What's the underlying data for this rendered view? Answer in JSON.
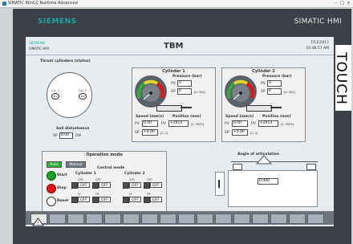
{
  "window": {
    "title": "SIMATIC WinCC Runtime Advanced"
  },
  "brand": {
    "siemens": "SIEMENS",
    "product": "SIMATIC HMI",
    "touch": "TOUCH"
  },
  "header": {
    "siemens": "SIEMENS",
    "hmi": "SIMATIC HMI",
    "title": "TBM",
    "date": "7/11/2017",
    "time": "10:48:57 AM"
  },
  "thrust": {
    "title": "Thrust cylinders (status)",
    "cyl1_label": "Cyl. 1",
    "cyl1_id": "#1",
    "cyl2_label": "Cyl. 2",
    "cyl2_id": "#2",
    "soil_label": "Soil disturbance",
    "sp_label": "SP",
    "sp_value": "0.00",
    "sp_unit": "ON"
  },
  "cylinder1": {
    "title": "Cylinder 1",
    "pressure_label": "Pressure (bar)",
    "pv_label": "PV",
    "pv_value": "0",
    "sp_label": "SP",
    "sp_value": "0",
    "pressure_range": "[0..350]",
    "speed_label": "Speed (mm/s)",
    "position_label": "Position (mm)",
    "speed_pv_label": "PV",
    "speed_pv": "0.00",
    "pos_pv_label": "PV",
    "pos_pv": "+2014",
    "pos_range": "[0..3000]",
    "speed_sp_label": "SP",
    "speed_sp": "+0.00",
    "speed_range": "[0..1]"
  },
  "cylinder2": {
    "title": "Cylinder 2",
    "pressure_label": "Pressure (bar)",
    "pv_label": "PV",
    "pv_value": "0",
    "sp_label": "SP",
    "sp_value": "0",
    "pressure_range": "[0..350]",
    "speed_label": "Speed (mm/s)",
    "position_label": "Position (mm)",
    "speed_pv_label": "PV",
    "speed_pv": "0.00",
    "pos_pv_label": "PV",
    "pos_pv": "+2014",
    "pos_range": "[0..3000]",
    "speed_sp_label": "SP",
    "speed_sp": "+0.00",
    "speed_range": "[0..1]"
  },
  "operation": {
    "title": "Operation mode",
    "auto": "Auto",
    "manual": "Manual",
    "control_mode": "Control mode",
    "start": "Start",
    "stop": "Stop",
    "reset": "Reset",
    "cyl1": "Cylinder 1",
    "cyl2": "Cylinder 2",
    "c1_a": "CFS",
    "c1_b": "CFP",
    "c1_c": "FF",
    "c1_d": "FR",
    "c2_a": "CFS",
    "c2_b": "CFP",
    "c2_c": "FF",
    "c2_d": "FR",
    "off": "OFF"
  },
  "articulation": {
    "title": "Angle of articulation",
    "value": "0.000"
  },
  "colors": {
    "accent": "#1aa6a6",
    "auto_green": "#2fae3a",
    "start_green": "#1ca02a",
    "stop_red": "#e3101a",
    "bezel": "#3c4148"
  }
}
